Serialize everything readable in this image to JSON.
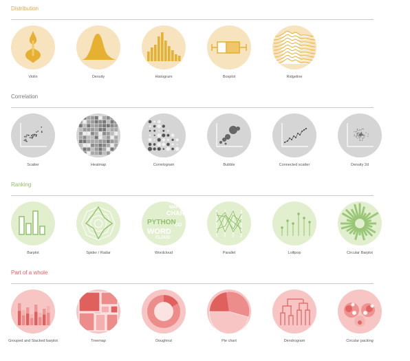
{
  "sections": [
    {
      "title": "Distribution",
      "color": "#e0a84a",
      "items": [
        {
          "label": "Violin",
          "icon": "violin-icon"
        },
        {
          "label": "Density",
          "icon": "density-icon"
        },
        {
          "label": "Histogram",
          "icon": "histogram-icon"
        },
        {
          "label": "Boxplot",
          "icon": "boxplot-icon"
        },
        {
          "label": "Ridgeline",
          "icon": "ridgeline-icon"
        }
      ]
    },
    {
      "title": "Correlation",
      "color": "#777777",
      "items": [
        {
          "label": "Scatter",
          "icon": "scatter-icon"
        },
        {
          "label": "Heatmap",
          "icon": "heatmap-icon"
        },
        {
          "label": "Correlogram",
          "icon": "correlogram-icon"
        },
        {
          "label": "Bubble",
          "icon": "bubble-icon"
        },
        {
          "label": "Connected scatter",
          "icon": "connected-scatter-icon"
        },
        {
          "label": "Density 2d",
          "icon": "density-2d-icon"
        }
      ]
    },
    {
      "title": "Ranking",
      "color": "#8fc06a",
      "items": [
        {
          "label": "Barplot",
          "icon": "barplot-icon"
        },
        {
          "label": "Spider / Radar",
          "icon": "spider-radar-icon"
        },
        {
          "label": "Wordcloud",
          "icon": "wordcloud-icon"
        },
        {
          "label": "Parallel",
          "icon": "parallel-icon"
        },
        {
          "label": "Lollipop",
          "icon": "lollipop-icon"
        },
        {
          "label": "Circular Barplot",
          "icon": "circular-barplot-icon"
        }
      ]
    },
    {
      "title": "Part of a whole",
      "color": "#e0605e",
      "items": [
        {
          "label": "Grouped and Stacked barplot",
          "icon": "grouped-stacked-barplot-icon"
        },
        {
          "label": "Treemap",
          "icon": "treemap-icon"
        },
        {
          "label": "Doughnut",
          "icon": "doughnut-icon"
        },
        {
          "label": "Pie chart",
          "icon": "pie-chart-icon"
        },
        {
          "label": "Dendrogram",
          "icon": "dendrogram-icon"
        },
        {
          "label": "Circular packing",
          "icon": "circular-packing-icon"
        }
      ]
    }
  ],
  "wordcloud_words": [
    "PYTHON",
    "WORD",
    "CHART",
    "CLOUD",
    "MAP",
    "CO"
  ]
}
